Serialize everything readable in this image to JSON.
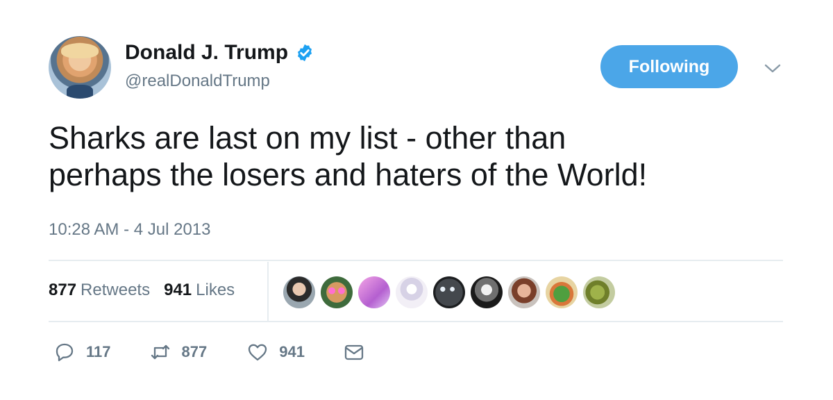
{
  "author": {
    "name": "Donald J. Trump",
    "handle": "@realDonaldTrump",
    "verified": true
  },
  "follow_button": {
    "label": "Following"
  },
  "tweet": {
    "text": "Sharks are last on my list - other than\nperhaps the losers and haters of the World!",
    "timestamp": "10:28 AM - 4 Jul 2013"
  },
  "stats": {
    "retweets_count": "877",
    "retweets_label": "Retweets",
    "likes_count": "941",
    "likes_label": "Likes"
  },
  "actions": {
    "reply_count": "117",
    "retweet_count": "877",
    "like_count": "941"
  },
  "icons": {
    "verified": "verified-badge-icon",
    "chevron": "chevron-down-icon",
    "reply": "reply-icon",
    "retweet": "retweet-icon",
    "like": "heart-icon",
    "message": "envelope-icon"
  },
  "colors": {
    "accent": "#4ba6e8",
    "text": "#14171a",
    "muted": "#657786",
    "divider": "#e6ecf0"
  }
}
